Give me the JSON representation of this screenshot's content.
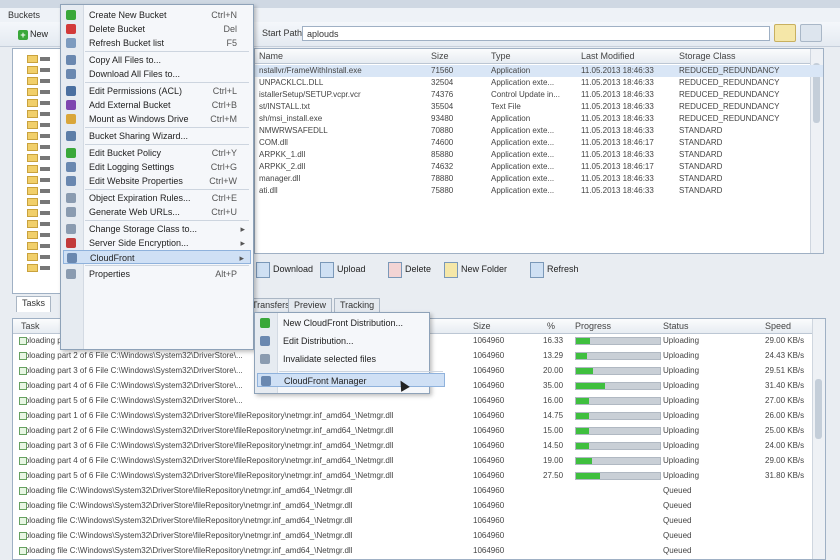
{
  "menubar": {
    "items": [
      "Buckets"
    ]
  },
  "toolbar": {
    "new_label": "New"
  },
  "address": {
    "label": "Start Path:",
    "value": "aplouds"
  },
  "tree": {
    "count": 20
  },
  "objects": {
    "columns": [
      "Name",
      "Size",
      "Type",
      "Last Modified",
      "Storage Class"
    ],
    "rows": [
      {
        "name": "nstallvr/FrameWithInstall.exe",
        "size": "71560",
        "type": "Application",
        "modified": "11.05.2013 18:46:33",
        "storage": "REDUCED_REDUNDANCY",
        "selected": true
      },
      {
        "name": "UNPACKLCL.DLL",
        "size": "32504",
        "type": "Application exte...",
        "modified": "11.05.2013 18:46:33",
        "storage": "REDUCED_REDUNDANCY"
      },
      {
        "name": "istallerSetup/SETUP.vcpr.vcr",
        "size": "74376",
        "type": "Control Update in...",
        "modified": "11.05.2013 18:46:33",
        "storage": "REDUCED_REDUNDANCY"
      },
      {
        "name": "st/INSTALL.txt",
        "size": "35504",
        "type": "Text File",
        "modified": "11.05.2013 18:46:33",
        "storage": "REDUCED_REDUNDANCY"
      },
      {
        "name": "sh/msi_install.exe",
        "size": "93480",
        "type": "Application",
        "modified": "11.05.2013 18:46:33",
        "storage": "REDUCED_REDUNDANCY"
      },
      {
        "name": "NMWRWSAFEDLL",
        "size": "70880",
        "type": "Application exte...",
        "modified": "11.05.2013 18:46:33",
        "storage": "STANDARD"
      },
      {
        "name": "COM.dll",
        "size": "74600",
        "type": "Application exte...",
        "modified": "11.05.2013 18:46:17",
        "storage": "STANDARD"
      },
      {
        "name": "ARPKK_1.dll",
        "size": "85880",
        "type": "Application exte...",
        "modified": "11.05.2013 18:46:33",
        "storage": "STANDARD"
      },
      {
        "name": "ARPKK_2.dll",
        "size": "74632",
        "type": "Application exte...",
        "modified": "11.05.2013 18:46:17",
        "storage": "STANDARD"
      },
      {
        "name": "manager.dll",
        "size": "78880",
        "type": "Application exte...",
        "modified": "11.05.2013 18:46:33",
        "storage": "STANDARD"
      },
      {
        "name": "ati.dll",
        "size": "75880",
        "type": "Application exte...",
        "modified": "11.05.2013 18:46:33",
        "storage": "STANDARD"
      }
    ]
  },
  "actions": [
    "Download",
    "Upload",
    "Delete",
    "New Folder",
    "Refresh"
  ],
  "tabs": [
    "Tasks",
    "Transfers",
    "Preview",
    "Tracking"
  ],
  "transfers": {
    "columns": [
      "Task",
      "Size",
      "%",
      "Progress",
      "Status",
      "Speed"
    ],
    "rows": [
      {
        "task": "Uploading part 1 of 6 File C:\\Windows\\System32\\DriverStore\\...",
        "size": "1064960",
        "pct": "16.33",
        "progress": 0.17,
        "status": "Uploading",
        "speed": "29.00 KB/s"
      },
      {
        "task": "Uploading part 2 of 6 File C:\\Windows\\System32\\DriverStore\\...",
        "size": "1064960",
        "pct": "13.29",
        "progress": 0.13,
        "status": "Uploading",
        "speed": "24.43 KB/s"
      },
      {
        "task": "Uploading part 3 of 6 File C:\\Windows\\System32\\DriverStore\\...",
        "size": "1064960",
        "pct": "20.00",
        "progress": 0.2,
        "status": "Uploading",
        "speed": "29.51 KB/s"
      },
      {
        "task": "Uploading part 4 of 6 File C:\\Windows\\System32\\DriverStore\\...",
        "size": "1064960",
        "pct": "35.00",
        "progress": 0.35,
        "status": "Uploading",
        "speed": "31.40 KB/s"
      },
      {
        "task": "Uploading part 5 of 6 File C:\\Windows\\System32\\DriverStore\\...",
        "size": "1064960",
        "pct": "16.00",
        "progress": 0.16,
        "status": "Uploading",
        "speed": "27.00 KB/s"
      },
      {
        "task": "Uploading part 1 of 6 File C:\\Windows\\System32\\DriverStore\\fileRepository\\netmgr.inf_amd64_\\Netmgr.dll",
        "size": "1064960",
        "pct": "14.75",
        "progress": 0.15,
        "status": "Uploading",
        "speed": "26.00 KB/s"
      },
      {
        "task": "Uploading part 2 of 6 File C:\\Windows\\System32\\DriverStore\\fileRepository\\netmgr.inf_amd64_\\Netmgr.dll",
        "size": "1064960",
        "pct": "15.00",
        "progress": 0.15,
        "status": "Uploading",
        "speed": "25.00 KB/s"
      },
      {
        "task": "Uploading part 3 of 6 File C:\\Windows\\System32\\DriverStore\\fileRepository\\netmgr.inf_amd64_\\Netmgr.dll",
        "size": "1064960",
        "pct": "14.50",
        "progress": 0.15,
        "status": "Uploading",
        "speed": "24.00 KB/s"
      },
      {
        "task": "Uploading part 4 of 6 File C:\\Windows\\System32\\DriverStore\\fileRepository\\netmgr.inf_amd64_\\Netmgr.dll",
        "size": "1064960",
        "pct": "19.00",
        "progress": 0.19,
        "status": "Uploading",
        "speed": "29.00 KB/s"
      },
      {
        "task": "Uploading part 5 of 6 File C:\\Windows\\System32\\DriverStore\\fileRepository\\netmgr.inf_amd64_\\Netmgr.dll",
        "size": "1064960",
        "pct": "27.50",
        "progress": 0.28,
        "status": "Uploading",
        "speed": "31.80 KB/s"
      },
      {
        "task": "Uploading file C:\\Windows\\System32\\DriverStore\\fileRepository\\netmgr.inf_amd64_\\Netmgr.dll",
        "size": "1064960",
        "pct": "",
        "progress": null,
        "status": "Queued",
        "speed": ""
      },
      {
        "task": "Uploading file C:\\Windows\\System32\\DriverStore\\fileRepository\\netmgr.inf_amd64_\\Netmgr.dll",
        "size": "1064960",
        "pct": "",
        "progress": null,
        "status": "Queued",
        "speed": ""
      },
      {
        "task": "Uploading file C:\\Windows\\System32\\DriverStore\\fileRepository\\netmgr.inf_amd64_\\Netmgr.dll",
        "size": "1064960",
        "pct": "",
        "progress": null,
        "status": "Queued",
        "speed": ""
      },
      {
        "task": "Uploading file C:\\Windows\\System32\\DriverStore\\fileRepository\\netmgr.inf_amd64_\\Netmgr.dll",
        "size": "1064960",
        "pct": "",
        "progress": null,
        "status": "Queued",
        "speed": ""
      },
      {
        "task": "Uploading file C:\\Windows\\System32\\DriverStore\\fileRepository\\netmgr.inf_amd64_\\Netmgr.dll",
        "size": "1064960",
        "pct": "",
        "progress": null,
        "status": "Queued",
        "speed": ""
      }
    ]
  },
  "context_menu": {
    "items": [
      {
        "label": "Create New Bucket",
        "shortcut": "Ctrl+N",
        "icon": "add-icon",
        "color": "#3aa83a"
      },
      {
        "label": "Delete Bucket",
        "shortcut": "Del",
        "icon": "delete-icon",
        "color": "#d23a3a"
      },
      {
        "label": "Refresh Bucket list",
        "shortcut": "F5",
        "icon": "refresh-icon",
        "color": "#7d9bbf"
      },
      {
        "sep": true
      },
      {
        "label": "Copy All Files to...",
        "shortcut": "",
        "icon": "copy-icon",
        "color": "#6a88b0"
      },
      {
        "label": "Download All Files to...",
        "shortcut": "",
        "icon": "download-icon",
        "color": "#6a88b0"
      },
      {
        "sep": true
      },
      {
        "label": "Edit Permissions (ACL)",
        "shortcut": "Ctrl+L",
        "icon": "users-icon",
        "color": "#4a6fa0"
      },
      {
        "label": "Add External Bucket",
        "shortcut": "Ctrl+B",
        "icon": "bucket-icon",
        "color": "#7e46b0"
      },
      {
        "label": "Mount as Windows Drive",
        "shortcut": "Ctrl+M",
        "icon": "drive-icon",
        "color": "#d9a63a"
      },
      {
        "sep": true
      },
      {
        "label": "Bucket Sharing Wizard...",
        "shortcut": "",
        "icon": "share-icon",
        "color": "#5d7ea8"
      },
      {
        "sep": true
      },
      {
        "label": "Edit Bucket Policy",
        "shortcut": "Ctrl+Y",
        "icon": "policy-icon",
        "color": "#3aa83a"
      },
      {
        "label": "Edit Logging Settings",
        "shortcut": "Ctrl+G",
        "icon": "logging-icon",
        "color": "#6a88b0"
      },
      {
        "label": "Edit Website Properties",
        "shortcut": "Ctrl+W",
        "icon": "website-icon",
        "color": "#6a88b0"
      },
      {
        "sep": true
      },
      {
        "label": "Object Expiration Rules...",
        "shortcut": "Ctrl+E",
        "icon": "expiration-icon",
        "color": "#8a9bb0"
      },
      {
        "label": "Generate Web URLs...",
        "shortcut": "Ctrl+U",
        "icon": "url-icon",
        "color": "#8a9bb0"
      },
      {
        "sep": true
      },
      {
        "label": "Change Storage Class to...",
        "shortcut": "",
        "icon": "storage-icon",
        "color": "#8a9bb0",
        "arrow": true
      },
      {
        "label": "Server Side Encryption...",
        "shortcut": "",
        "icon": "encryption-icon",
        "color": "#c23a3a",
        "arrow": true
      },
      {
        "label": "CloudFront",
        "shortcut": "",
        "icon": "cloudfront-icon",
        "color": "#6a88b0",
        "arrow": true,
        "highlighted": true
      },
      {
        "sep": true
      },
      {
        "label": "Properties",
        "shortcut": "Alt+P",
        "icon": "properties-icon",
        "color": "#8a9bb0"
      }
    ]
  },
  "submenu": {
    "items": [
      {
        "label": "New CloudFront Distribution...",
        "icon": "add-icon",
        "color": "#3aa83a"
      },
      {
        "label": "Edit Distribution...",
        "icon": "edit-icon",
        "color": "#6a88b0"
      },
      {
        "label": "Invalidate selected files",
        "icon": "invalidate-icon",
        "color": "#8a9bb0"
      },
      {
        "sep": true
      },
      {
        "label": "CloudFront Manager",
        "icon": "manager-icon",
        "color": "#6a88b0",
        "highlighted": true
      }
    ]
  }
}
